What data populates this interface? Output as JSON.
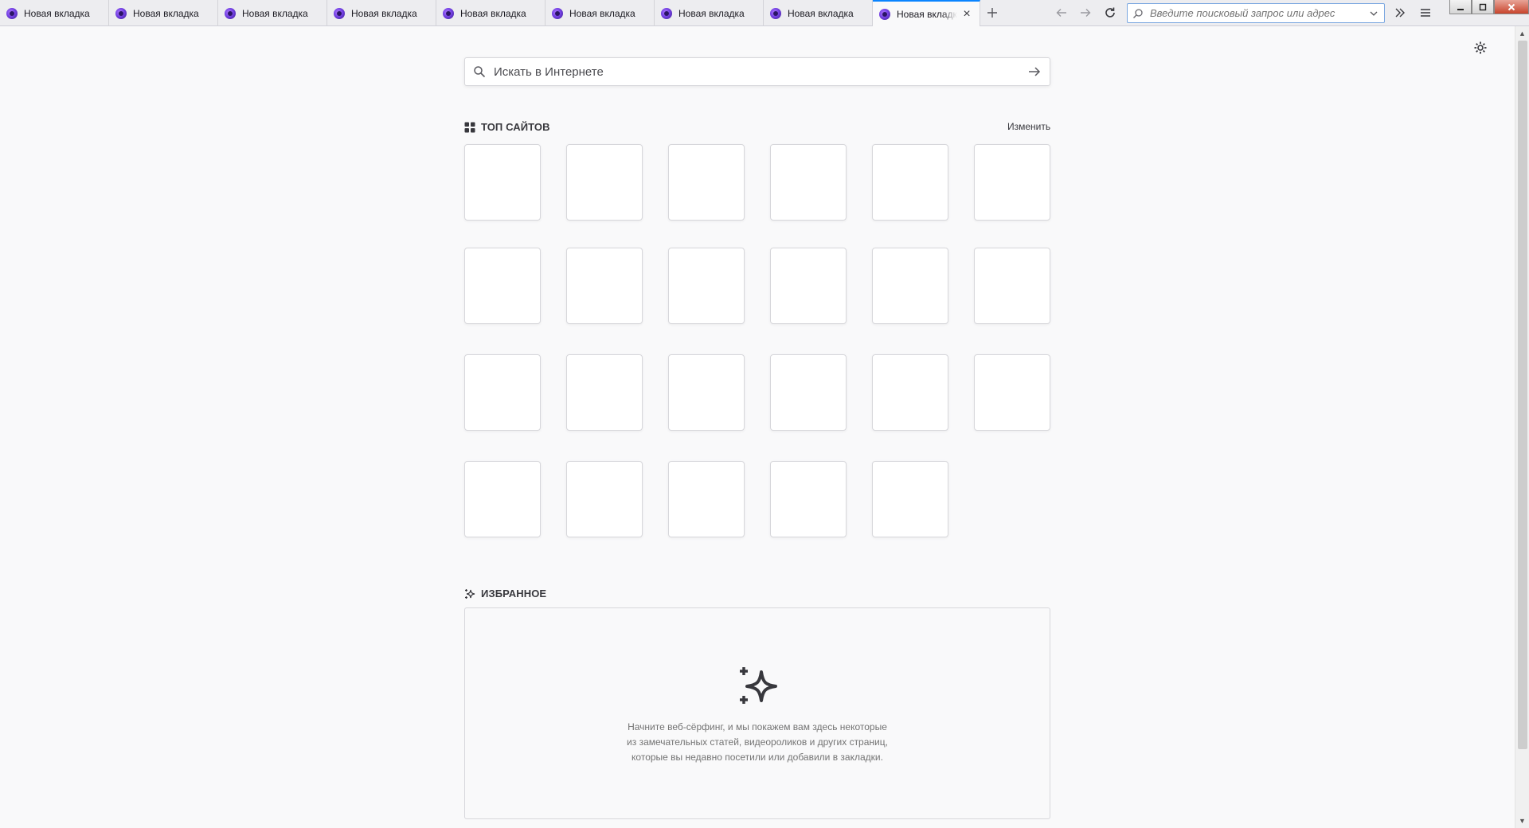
{
  "tabs": [
    {
      "label": "Новая вкладка",
      "active": false
    },
    {
      "label": "Новая вкладка",
      "active": false
    },
    {
      "label": "Новая вкладка",
      "active": false
    },
    {
      "label": "Новая вкладка",
      "active": false
    },
    {
      "label": "Новая вкладка",
      "active": false
    },
    {
      "label": "Новая вкладка",
      "active": false
    },
    {
      "label": "Новая вкладка",
      "active": false
    },
    {
      "label": "Новая вкладка",
      "active": false
    },
    {
      "label": "Новая вкладка",
      "active": true
    }
  ],
  "toolbar": {
    "urlbar_placeholder": "Введите поисковый запрос или адрес",
    "icons": {
      "new_tab": "plus-icon",
      "back": "arrow-left-icon",
      "forward": "arrow-right-icon",
      "reload": "reload-icon",
      "overflow": "double-chevron-right-icon",
      "menu": "hamburger-menu-icon"
    }
  },
  "newtab": {
    "search_placeholder": "Искать в Интернете",
    "top_sites": {
      "title": "ТОП САЙТОВ",
      "edit_label": "Изменить",
      "tile_count": 23
    },
    "highlights": {
      "title": "ИЗБРАННОЕ",
      "empty_lines": [
        "Начните веб-сёрфинг, и мы покажем вам здесь некоторые",
        "из замечательных статей, видеороликов и других страниц,",
        "которые вы недавно посетили или добавили в закладки."
      ]
    }
  },
  "colors": {
    "background": "#f9f9fa",
    "accent": "#0a84ff",
    "tile_border": "#d7d7db"
  }
}
